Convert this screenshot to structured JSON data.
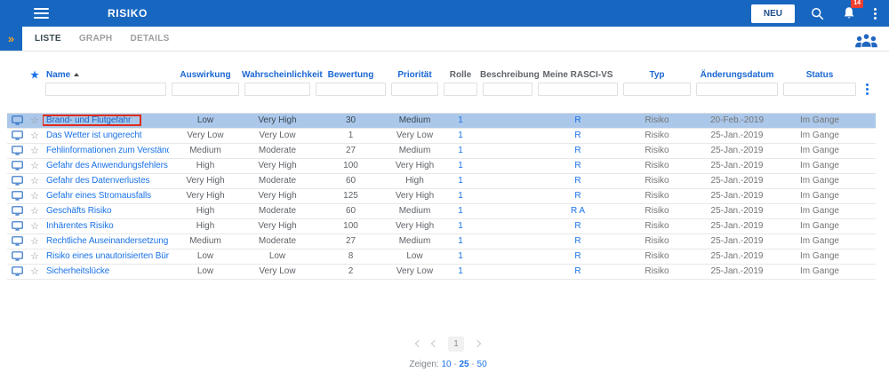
{
  "colors": {
    "app_bar": "#1767C0",
    "accent_link": "#1A73E8",
    "expand_chevrons": "#F5A623",
    "notification_badge": "#F03E2E",
    "selected_row": "#ABC8EA",
    "annotation_box": "#DF2B1B"
  },
  "app_bar": {
    "title": "RISIKO",
    "new_button_label": "NEU",
    "notification_count": "14"
  },
  "tab_bar": {
    "tabs": [
      {
        "label": "LISTE",
        "active": true
      },
      {
        "label": "GRAPH",
        "active": false
      },
      {
        "label": "DETAILS",
        "active": false
      }
    ]
  },
  "table": {
    "sort": {
      "column": "Name",
      "direction": "asc"
    },
    "columns": {
      "name": "Name",
      "auswirkung": "Auswirkung",
      "wahrscheinlichkeit": "Wahrscheinlichkeit",
      "bewertung": "Bewertung",
      "prioritaet": "Priorität",
      "rolle": "Rolle",
      "beschreibung": "Beschreibung",
      "rasci": "Meine RASCI-VS",
      "typ": "Typ",
      "datum": "Änderungsdatum",
      "status": "Status"
    },
    "rows": [
      {
        "name": "Brand- und Flutgefahr",
        "auswirkung": "Low",
        "wahrscheinlichkeit": "Very High",
        "bewertung": "30",
        "prioritaet": "Medium",
        "rolle": "1",
        "beschreibung": "",
        "rasci": "R",
        "typ": "Risiko",
        "datum": "20-Feb.-2019",
        "status": "Im Gange",
        "selected": true,
        "annotated": true
      },
      {
        "name": "Das Wetter ist ungerecht",
        "auswirkung": "Very Low",
        "wahrscheinlichkeit": "Very Low",
        "bewertung": "1",
        "prioritaet": "Very Low",
        "rolle": "1",
        "beschreibung": "",
        "rasci": "R",
        "typ": "Risiko",
        "datum": "25-Jan.-2019",
        "status": "Im Gange",
        "selected": false,
        "annotated": false
      },
      {
        "name": "Fehlinformationen zum Verständnis v...",
        "auswirkung": "Medium",
        "wahrscheinlichkeit": "Moderate",
        "bewertung": "27",
        "prioritaet": "Medium",
        "rolle": "1",
        "beschreibung": "",
        "rasci": "R",
        "typ": "Risiko",
        "datum": "25-Jan.-2019",
        "status": "Im Gange",
        "selected": false,
        "annotated": false
      },
      {
        "name": "Gefahr des Anwendungsfehlers",
        "auswirkung": "High",
        "wahrscheinlichkeit": "Very High",
        "bewertung": "100",
        "prioritaet": "Very High",
        "rolle": "1",
        "beschreibung": "",
        "rasci": "R",
        "typ": "Risiko",
        "datum": "25-Jan.-2019",
        "status": "Im Gange",
        "selected": false,
        "annotated": false
      },
      {
        "name": "Gefahr des Datenverlustes",
        "auswirkung": "Very High",
        "wahrscheinlichkeit": "Moderate",
        "bewertung": "60",
        "prioritaet": "High",
        "rolle": "1",
        "beschreibung": "",
        "rasci": "R",
        "typ": "Risiko",
        "datum": "25-Jan.-2019",
        "status": "Im Gange",
        "selected": false,
        "annotated": false
      },
      {
        "name": "Gefahr eines Stromausfalls",
        "auswirkung": "Very High",
        "wahrscheinlichkeit": "Very High",
        "bewertung": "125",
        "prioritaet": "Very High",
        "rolle": "1",
        "beschreibung": "",
        "rasci": "R",
        "typ": "Risiko",
        "datum": "25-Jan.-2019",
        "status": "Im Gange",
        "selected": false,
        "annotated": false
      },
      {
        "name": "Geschäfts Risiko",
        "auswirkung": "High",
        "wahrscheinlichkeit": "Moderate",
        "bewertung": "60",
        "prioritaet": "Medium",
        "rolle": "1",
        "beschreibung": "",
        "rasci": "R A",
        "typ": "Risiko",
        "datum": "25-Jan.-2019",
        "status": "Im Gange",
        "selected": false,
        "annotated": false
      },
      {
        "name": "Inhärentes Risiko",
        "auswirkung": "High",
        "wahrscheinlichkeit": "Very High",
        "bewertung": "100",
        "prioritaet": "Very High",
        "rolle": "1",
        "beschreibung": "",
        "rasci": "R",
        "typ": "Risiko",
        "datum": "25-Jan.-2019",
        "status": "Im Gange",
        "selected": false,
        "annotated": false
      },
      {
        "name": "Rechtliche Auseinandersetzung mit K...",
        "auswirkung": "Medium",
        "wahrscheinlichkeit": "Moderate",
        "bewertung": "27",
        "prioritaet": "Medium",
        "rolle": "1",
        "beschreibung": "",
        "rasci": "R",
        "typ": "Risiko",
        "datum": "25-Jan.-2019",
        "status": "Im Gange",
        "selected": false,
        "annotated": false
      },
      {
        "name": "Risiko eines unautorisierten Büros",
        "auswirkung": "Low",
        "wahrscheinlichkeit": "Low",
        "bewertung": "8",
        "prioritaet": "Low",
        "rolle": "1",
        "beschreibung": "",
        "rasci": "R",
        "typ": "Risiko",
        "datum": "25-Jan.-2019",
        "status": "Im Gange",
        "selected": false,
        "annotated": false
      },
      {
        "name": "Sicherheitslücke",
        "auswirkung": "Low",
        "wahrscheinlichkeit": "Very Low",
        "bewertung": "2",
        "prioritaet": "Very Low",
        "rolle": "1",
        "beschreibung": "",
        "rasci": "R",
        "typ": "Risiko",
        "datum": "25-Jan.-2019",
        "status": "Im Gange",
        "selected": false,
        "annotated": false
      }
    ]
  },
  "pagination": {
    "page": "1",
    "zeigen_label": "Zeigen:",
    "page_sizes": [
      "10",
      "25",
      "50"
    ],
    "active_page_size": "25"
  }
}
